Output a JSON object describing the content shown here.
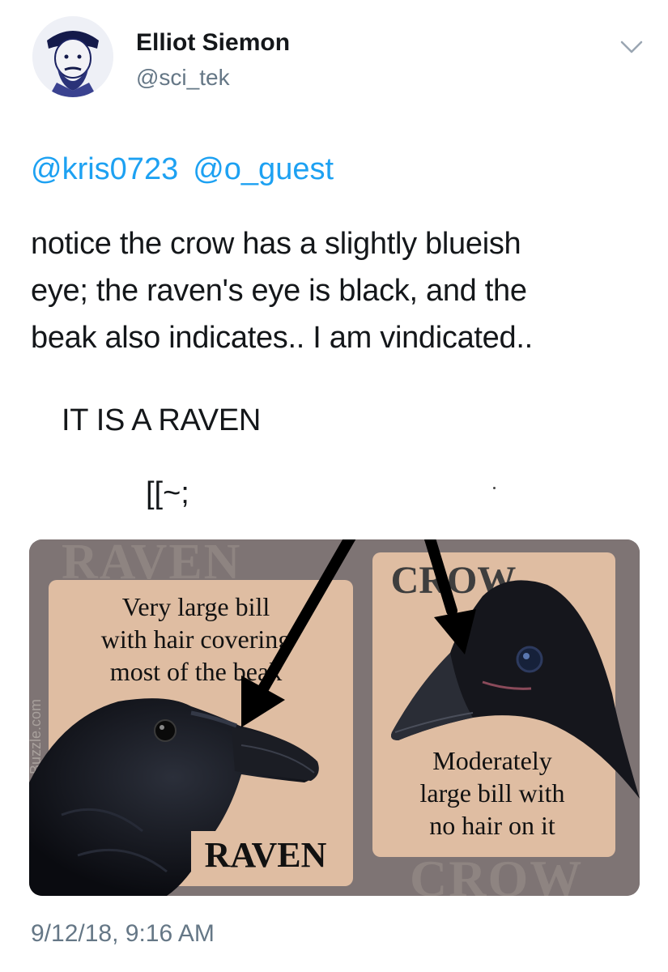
{
  "tweet": {
    "author": {
      "display_name": "Elliot Siemon",
      "handle": "@sci_tek",
      "avatar_icon": "avatar-portrait-icon"
    },
    "menu_icon": "chevron-down-icon",
    "mentions": [
      "@kris0723",
      "@o_guest"
    ],
    "text_lines": [
      "notice the crow has a slightly blueish",
      "eye; the raven's eye is black, and the",
      "beak also indicates.. I am vindicated.."
    ],
    "emphasis_line": "IT IS A RAVEN",
    "emoticon": "[[~;",
    "timestamp": "9/12/18, 9:16 AM"
  },
  "image": {
    "watermark_raven": "RAVEN",
    "watermark_crow": "CROW",
    "side_credit": "Buzzle.com",
    "raven_panel": {
      "caption_lines": [
        "Very large bill",
        "with hair covering",
        "most of the beak"
      ],
      "label": "RAVEN"
    },
    "crow_panel": {
      "title": "CROW",
      "caption_lines": [
        "Moderately",
        "large bill with",
        "no hair on it"
      ]
    },
    "colors": {
      "frame": "#7e7474",
      "panel": "#dfbda2",
      "arrow": "#000000"
    }
  }
}
